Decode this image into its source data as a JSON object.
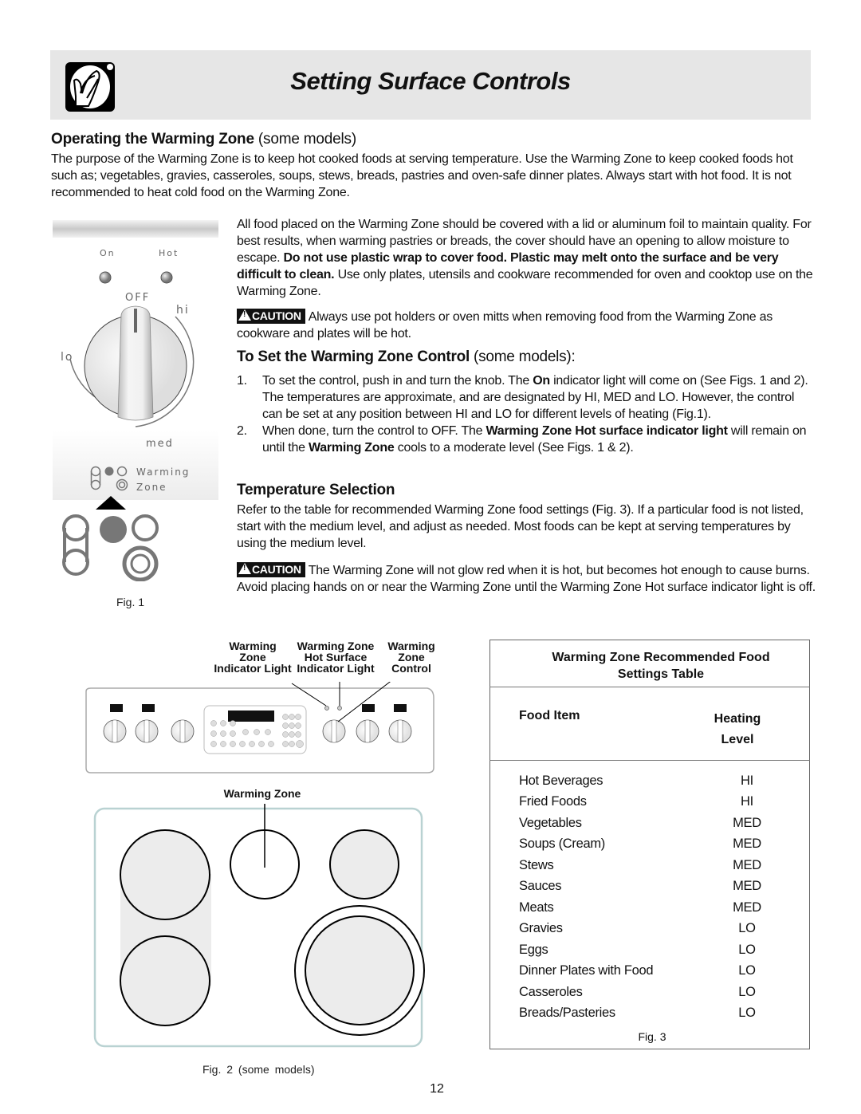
{
  "header": {
    "title": "Setting Surface Controls",
    "icon": "hand-pot-icon"
  },
  "section_operating": {
    "heading_bold": "Operating the Warming Zone",
    "heading_light": " (some models)",
    "intro": "The purpose of the Warming Zone is to keep hot cooked foods at serving temperature. Use the Warming Zone to keep cooked foods hot such as; vegetables, gravies, casseroles, soups, stews, breads, pastries and oven-safe dinner plates. Always start with hot food. It is not recommended to heat cold food on the Warming Zone.",
    "para1_a": "All food placed on the Warming Zone should be covered with a lid or aluminum foil to maintain quality.  For best results, when warming pastries or breads, the cover should have an opening to allow moisture to escape. ",
    "para1_bold": "Do not use plastic wrap to cover food. Plastic may melt onto the surface and be very difficult to clean.",
    "para1_b": " Use only plates, utensils and cookware recommended for oven and cooktop use on the Warming Zone.",
    "caution_label": "CAUTION",
    "caution1": "Always use pot holders or oven mitts when removing food from the Warming Zone as cookware and plates will be hot."
  },
  "section_set": {
    "heading_bold": "To Set the Warming Zone Control",
    "heading_light": " (some models):",
    "steps": [
      {
        "num": "1.",
        "a": "To set the control, push in and turn the knob. The ",
        "bold": "On",
        "b": " indicator light will come on (See Figs. 1 and 2). The temperatures are approximate, and are designated by HI, MED and LO. However, the control can be set at any position between HI and LO for different levels of heating (Fig.1).",
        "bold2": "",
        "c": ""
      },
      {
        "num": "2.",
        "a": "When done, turn the control to OFF. The ",
        "bold": "Warming Zone Hot surface indicator light",
        "b": " will remain on until the ",
        "bold2": "Warming Zone",
        "c": " cools to a moderate level (See Figs. 1 & 2)."
      }
    ]
  },
  "section_temp": {
    "heading": "Temperature Selection",
    "para": "Refer to the table for recommended Warming Zone food settings (Fig. 3). If a particular food is not listed, start with the medium level, and adjust as needed. Most foods can be kept at serving temperatures by using the medium level.",
    "caution_label": "CAUTION",
    "caution2": "The Warming Zone will not glow red when it is hot, but becomes hot enough to cause burns.  Avoid placing hands on or near the Warming Zone until the Warming Zone Hot surface indicator light is off."
  },
  "fig1": {
    "on_label": "On",
    "hot_label": "Hot",
    "off_label": "OFF",
    "hi_label": "hi",
    "lo_label": "lo",
    "med_label": "med",
    "zone_label_1": "Warming",
    "zone_label_2": "Zone",
    "caption": "Fig. 1"
  },
  "fig2": {
    "callouts": [
      "Warming Zone Indicator Light",
      "Warming Zone Hot Surface Indicator Light",
      "Warming Zone Control"
    ],
    "callout_lines": [
      [
        "Warming",
        "Zone",
        "Indicator Light"
      ],
      [
        "Warming Zone",
        "Hot Surface",
        "Indicator Light"
      ],
      [
        "Warming",
        "Zone",
        "Control"
      ]
    ],
    "warming_zone_label": "Warming Zone",
    "caption": "Fig. 2  (some  models)"
  },
  "table": {
    "title_line1": "Warming Zone Recommended Food",
    "title_line2": "Settings Table",
    "col_food": "Food Item",
    "col_level_1": "Heating",
    "col_level_2": "Level",
    "rows": [
      {
        "food": "Hot Beverages",
        "level": "HI"
      },
      {
        "food": "Fried Foods",
        "level": "HI"
      },
      {
        "food": "Vegetables",
        "level": "MED"
      },
      {
        "food": "Soups (Cream)",
        "level": "MED"
      },
      {
        "food": "Stews",
        "level": "MED"
      },
      {
        "food": "Sauces",
        "level": "MED"
      },
      {
        "food": "Meats",
        "level": "MED"
      },
      {
        "food": "Gravies",
        "level": "LO"
      },
      {
        "food": "Eggs",
        "level": "LO"
      },
      {
        "food": "Dinner Plates with Food",
        "level": "LO"
      },
      {
        "food": "Casseroles",
        "level": "LO"
      },
      {
        "food": "Breads/Pasteries",
        "level": "LO"
      }
    ],
    "caption": "Fig. 3"
  },
  "page_number": "12"
}
